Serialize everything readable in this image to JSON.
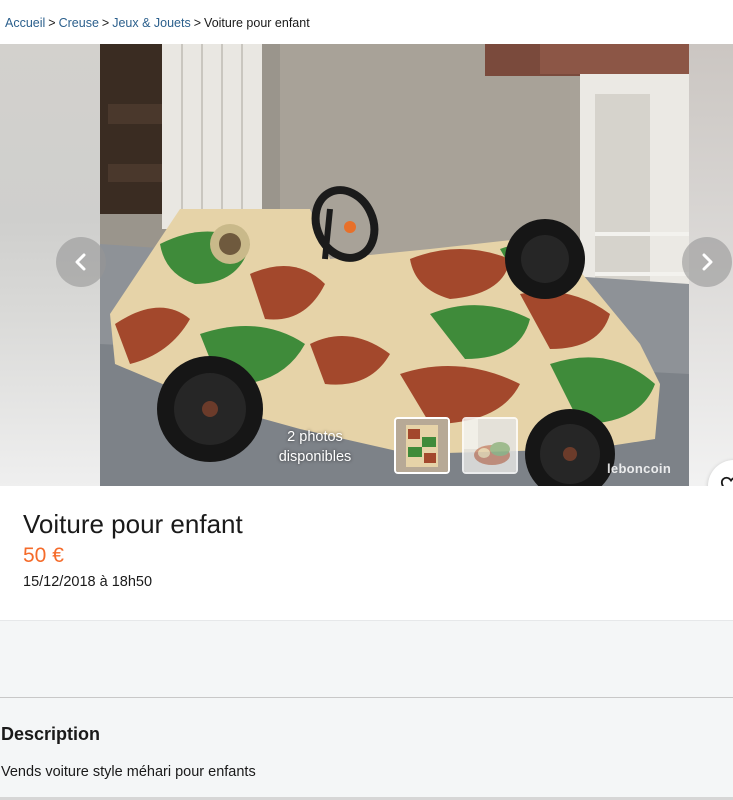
{
  "breadcrumb": {
    "items": [
      "Accueil",
      "Creuse",
      "Jeux & Jouets"
    ],
    "separator": ">",
    "current": "Voiture pour enfant"
  },
  "gallery": {
    "photo_count_line1": "2 photos",
    "photo_count_line2": "disponibles",
    "watermark": "leboncoin",
    "prev_icon": "chevron-left-icon",
    "next_icon": "chevron-right-icon",
    "favorite_icon": "heart-icon"
  },
  "listing": {
    "title": "Voiture pour enfant",
    "price": "50 €",
    "date": "15/12/2018 à 18h50"
  },
  "description": {
    "heading": "Description",
    "text": "Vends voiture style méhari pour enfants"
  },
  "colors": {
    "price": "#f56b2a",
    "link": "#2b5f8c"
  }
}
